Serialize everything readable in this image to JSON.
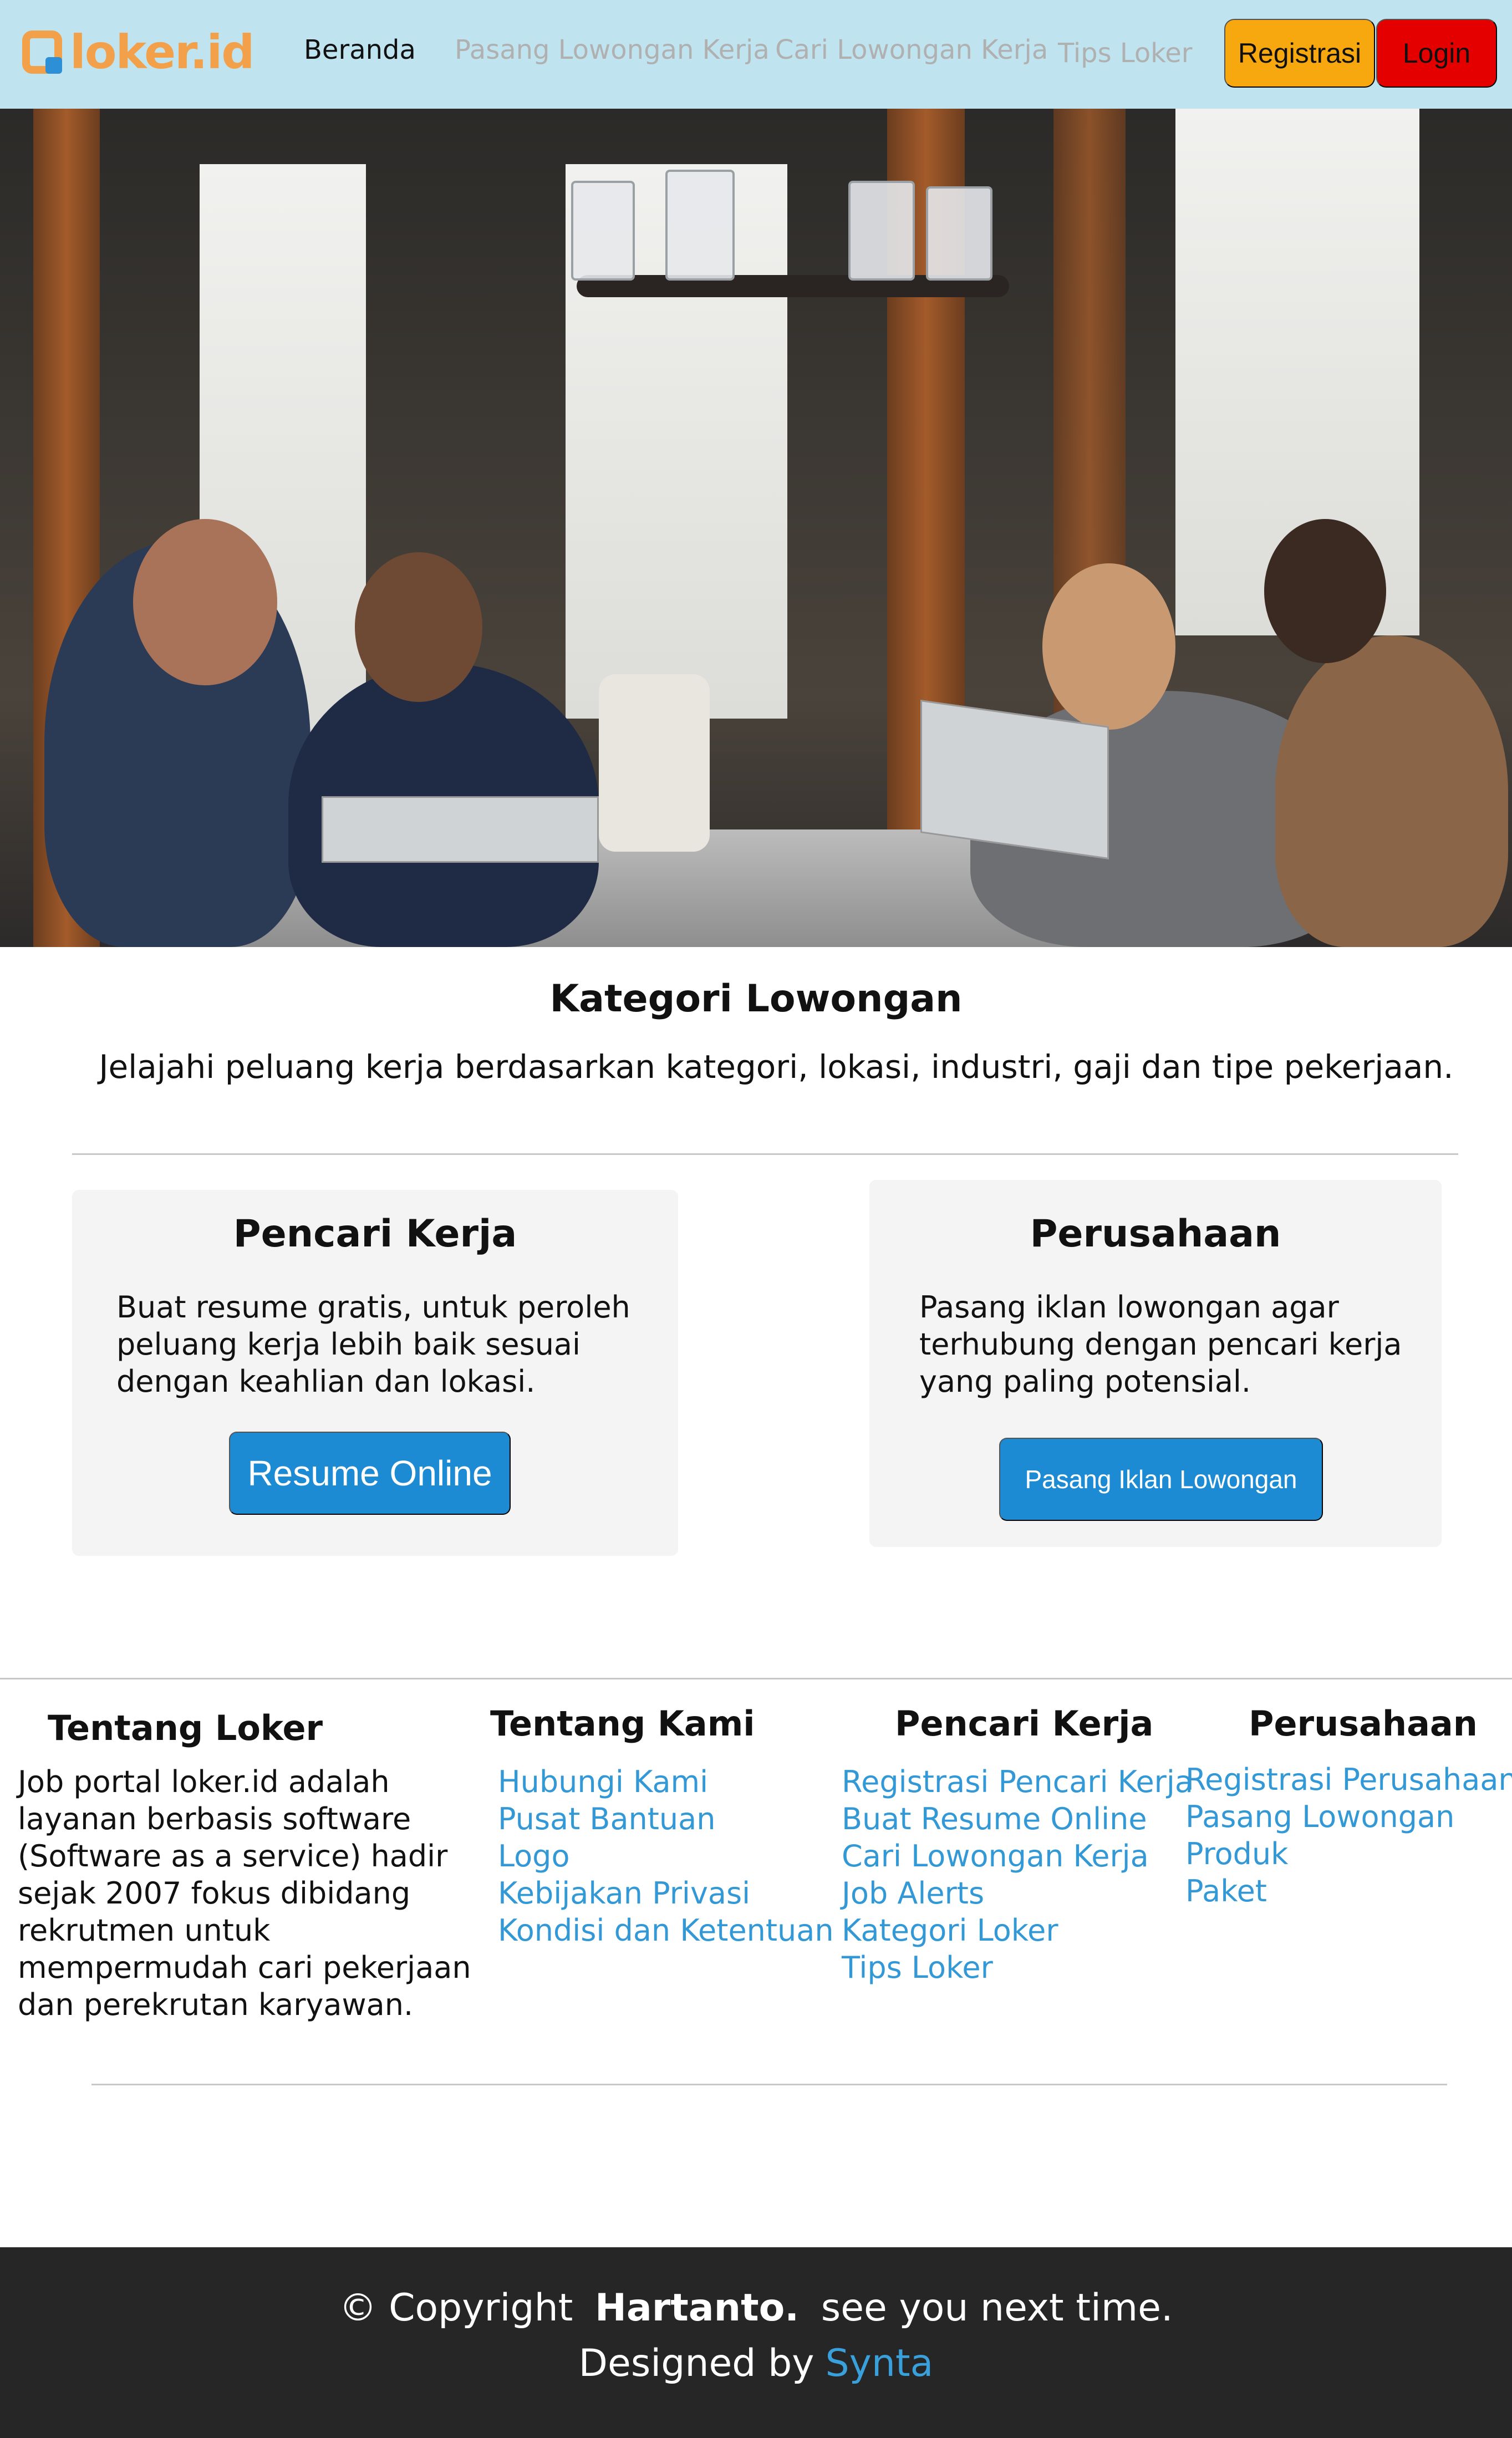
{
  "navbar": {
    "logo_text": "loker.id",
    "links": [
      "Beranda",
      "Pasang Lowongan Kerja",
      "Cari Lowongan Kerja",
      "Tips Loker"
    ],
    "register_label": "Registrasi",
    "login_label": "Login",
    "colors": {
      "bg": "#bfe4f0",
      "register": "#f7a80f",
      "login": "#e50000"
    }
  },
  "category": {
    "title": "Kategori Lowongan",
    "subtitle": "Jelajahi peluang kerja berdasarkan kategori, lokasi, industri, gaji dan tipe pekerjaan."
  },
  "cards": {
    "job_seeker": {
      "title": "Pencari Kerja",
      "text": "Buat resume gratis, untuk peroleh peluang kerja lebih baik sesuai dengan keahlian dan lokasi.",
      "button": "Resume Online"
    },
    "company": {
      "title": "Perusahaan",
      "text": "Pasang iklan lowongan agar terhubung dengan pencari kerja yang paling potensial.",
      "button": "Pasang Iklan Lowongan"
    }
  },
  "footer": {
    "about": {
      "title": "Tentang Loker",
      "text": "Job portal loker.id adalah layanan berbasis software (Software as a service) hadir sejak 2007 fokus dibidang rekrutmen untuk mempermudah cari pekerjaan dan perekrutan karyawan."
    },
    "about_us": {
      "title": "Tentang Kami",
      "links": [
        "Hubungi Kami",
        "Pusat Bantuan",
        "Logo",
        "Kebijakan Privasi",
        "Kondisi dan Ketentuan"
      ]
    },
    "job_seeker": {
      "title": "Pencari Kerja",
      "links": [
        "Registrasi Pencari Kerja",
        "Buat Resume Online",
        "Cari Lowongan Kerja",
        "Job Alerts",
        "Kategori Loker",
        "Tips Loker"
      ]
    },
    "company": {
      "title": "Perusahaan",
      "links": [
        "Registrasi Perusahaan",
        "Pasang Lowongan",
        "Produk",
        "Paket"
      ]
    },
    "link_color": "#3399d6"
  },
  "bottom_bar": {
    "copyright_symbol": "©",
    "copyright_label": "Copyright",
    "brand": "Hartanto.",
    "tagline": "see you next time.",
    "designed_by": "Designed by",
    "designer": "Synta",
    "bg": "#262626"
  }
}
